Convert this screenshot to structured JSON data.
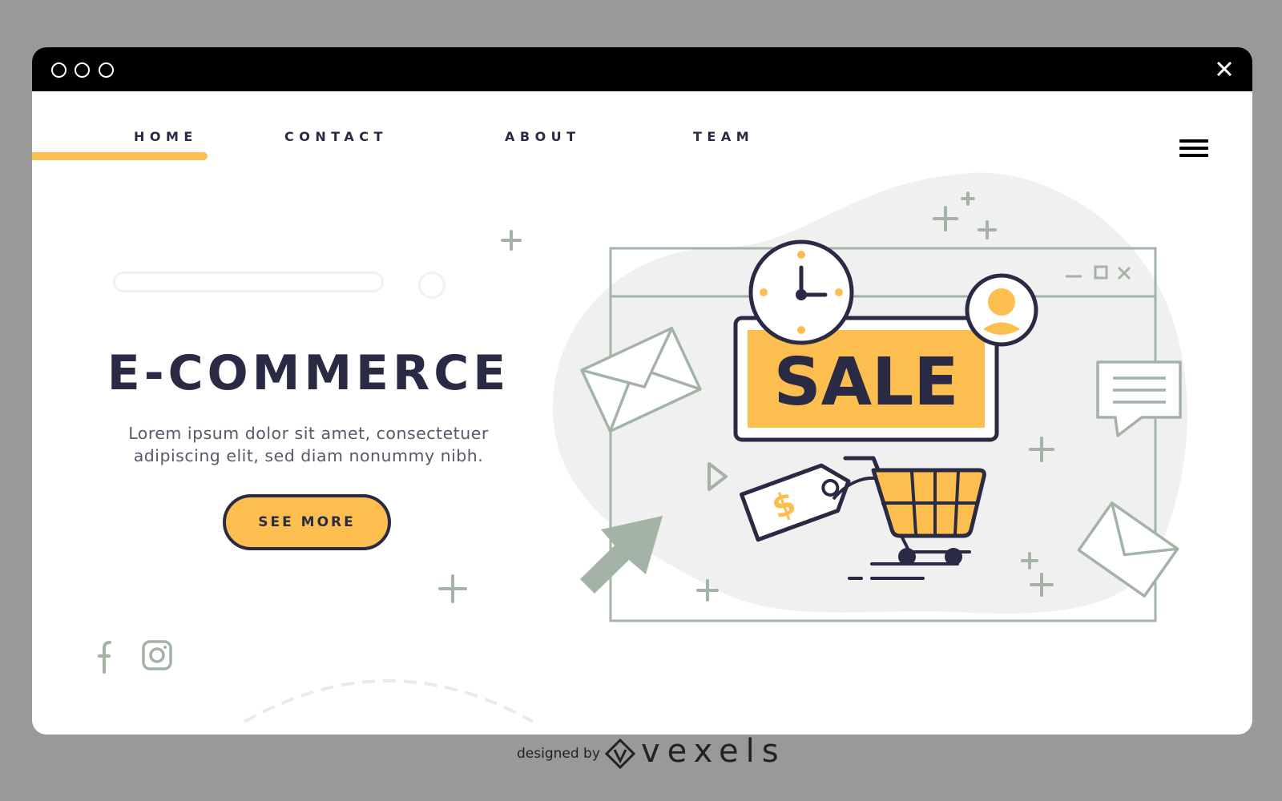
{
  "window": {
    "controls": [
      "circle",
      "circle",
      "circle"
    ],
    "close_icon": "close-icon"
  },
  "nav": {
    "items": [
      {
        "label": "HOME",
        "active": true
      },
      {
        "label": "CONTACT",
        "active": false
      },
      {
        "label": "ABOUT",
        "active": false
      },
      {
        "label": "TEAM",
        "active": false
      }
    ],
    "menu_icon": "hamburger-menu-icon"
  },
  "hero": {
    "title": "E-COMMERCE",
    "text_line1": "Lorem ipsum dolor sit amet, consectetuer",
    "text_line2": "adipiscing elit, sed diam nonummy nibh.",
    "button_label": "SEE MORE"
  },
  "illustration": {
    "sale_label": "SALE",
    "price_symbol": "$"
  },
  "social": {
    "icons": [
      "facebook-icon",
      "instagram-icon"
    ]
  },
  "footer": {
    "designed_by": "designed by",
    "brand": "vexels"
  },
  "colors": {
    "accent": "#fcbf4f",
    "dark": "#2a2a44",
    "sage": "#a3b3a5",
    "light_blob": "#f0f0f0",
    "background": "#999999"
  }
}
